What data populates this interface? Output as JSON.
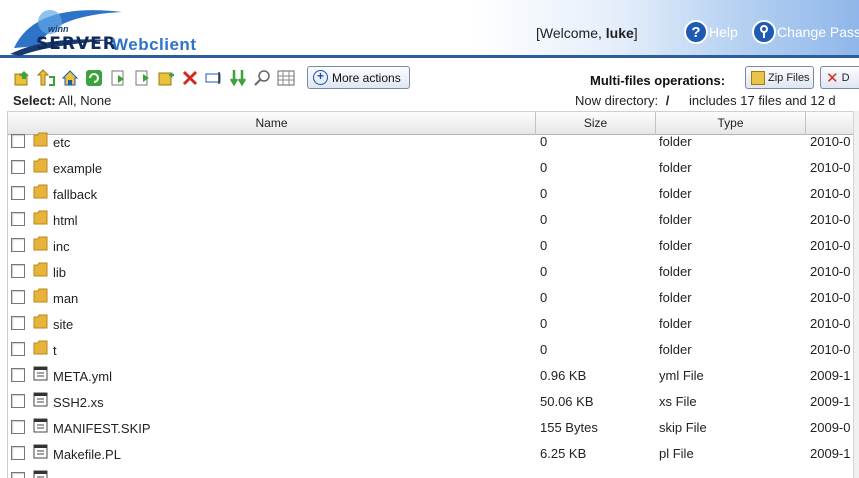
{
  "header": {
    "logo_small": "winn",
    "logo_server": "SERVER",
    "logo_product": "Webclient",
    "welcome_prefix": "[Welcome, ",
    "username": "luke",
    "welcome_suffix": "]",
    "help_label": "Help",
    "change_password_label": "Change Pass"
  },
  "toolbar": {
    "icons": [
      "upload-icon",
      "up-level-icon",
      "home-icon",
      "refresh-icon",
      "new-folder-icon",
      "new-file-icon",
      "copy-icon",
      "delete-icon",
      "rename-icon",
      "move-icon",
      "search-icon",
      "properties-icon"
    ],
    "more_actions_label": "More actions",
    "multi_files_label": "Multi-files operations:",
    "zip_label": "Zip Files",
    "delete_label": "D",
    "select_label": "Select:",
    "select_all": "All",
    "select_none": "None",
    "now_directory_label": "Now directory:",
    "current_dir": "/",
    "includes_text": "includes 17 files and 12 d"
  },
  "table": {
    "columns": [
      "Name",
      "Size",
      "Type"
    ],
    "rows": [
      {
        "name": "etc",
        "size": "0",
        "type": "folder",
        "date": "2010-0",
        "kind": "folder"
      },
      {
        "name": "example",
        "size": "0",
        "type": "folder",
        "date": "2010-0",
        "kind": "folder"
      },
      {
        "name": "fallback",
        "size": "0",
        "type": "folder",
        "date": "2010-0",
        "kind": "folder"
      },
      {
        "name": "html",
        "size": "0",
        "type": "folder",
        "date": "2010-0",
        "kind": "folder"
      },
      {
        "name": "inc",
        "size": "0",
        "type": "folder",
        "date": "2010-0",
        "kind": "folder"
      },
      {
        "name": "lib",
        "size": "0",
        "type": "folder",
        "date": "2010-0",
        "kind": "folder"
      },
      {
        "name": "man",
        "size": "0",
        "type": "folder",
        "date": "2010-0",
        "kind": "folder"
      },
      {
        "name": "site",
        "size": "0",
        "type": "folder",
        "date": "2010-0",
        "kind": "folder"
      },
      {
        "name": "t",
        "size": "0",
        "type": "folder",
        "date": "2010-0",
        "kind": "folder"
      },
      {
        "name": "META.yml",
        "size": "0.96 KB",
        "type": "yml File",
        "date": "2009-1",
        "kind": "file"
      },
      {
        "name": "SSH2.xs",
        "size": "50.06 KB",
        "type": "xs File",
        "date": "2009-1",
        "kind": "file"
      },
      {
        "name": "MANIFEST.SKIP",
        "size": "155 Bytes",
        "type": "skip File",
        "date": "2009-0",
        "kind": "file"
      },
      {
        "name": "Makefile.PL",
        "size": "6.25 KB",
        "type": "pl File",
        "date": "2009-1",
        "kind": "file"
      },
      {
        "name": "",
        "size": "",
        "type": "",
        "date": "",
        "kind": "file"
      }
    ]
  },
  "colors": {
    "header_border": "#2c5d9e",
    "folder": "#e8b33a",
    "accent": "#1f5bb5"
  }
}
